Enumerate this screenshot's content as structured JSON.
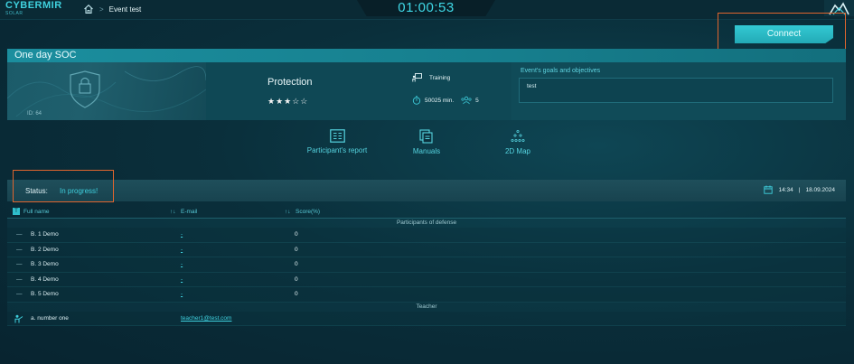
{
  "topbar": {
    "logo_main": "CYBERMIR",
    "logo_sub": "SOLAR",
    "breadcrumb_sep": ">",
    "page_title": "Event test",
    "timer": "01:00:53"
  },
  "connect_label": "Connect",
  "event": {
    "title": "One day SOC",
    "id_text": "ID: 64",
    "category": "Protection",
    "stars": "★★★☆☆",
    "stars_value": 3,
    "stars_max": 5,
    "type": "Training",
    "duration": "50025 min.",
    "participants_count": "5",
    "goals_title": "Event's goals and objectives",
    "goals_text": "test"
  },
  "nav": {
    "report": "Participant's report",
    "manuals": "Manuals",
    "map2d": "2D Map"
  },
  "status": {
    "label": "Status:",
    "value": "In progress!",
    "time": "14:34",
    "date_sep": "|",
    "date": "18.09.2024"
  },
  "table": {
    "col_fullname": "Full name",
    "col_email": "E-mail",
    "col_score": "Score(%)",
    "sort_icon": "↑↓",
    "group_defense": "Participants of defense",
    "group_teacher": "Teacher",
    "participants": [
      {
        "dash": "—",
        "name": "B. 1 Demo",
        "email": "-",
        "score": "0"
      },
      {
        "dash": "—",
        "name": "B. 2 Demo",
        "email": "-",
        "score": "0"
      },
      {
        "dash": "—",
        "name": "B. 3 Demo",
        "email": "-",
        "score": "0"
      },
      {
        "dash": "—",
        "name": "B. 4 Demo",
        "email": "-",
        "score": "0"
      },
      {
        "dash": "—",
        "name": "B. 5 Demo",
        "email": "-",
        "score": "0"
      }
    ],
    "teacher": {
      "name": "a. number one",
      "email": "teacher1@test.com"
    }
  },
  "colors": {
    "accent": "#3fd0de",
    "highlight_frame": "#e0652e",
    "background": "#0a2f3b"
  }
}
